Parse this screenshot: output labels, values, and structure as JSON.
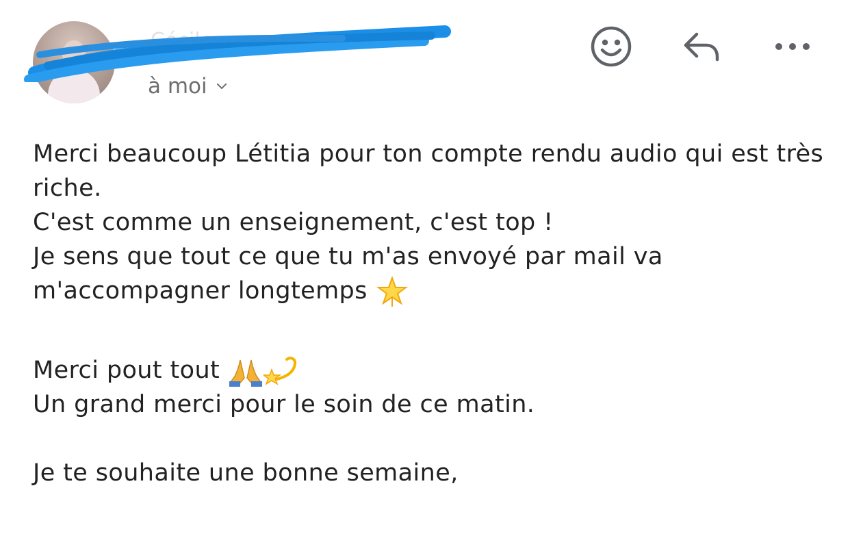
{
  "header": {
    "sender_name": "Cécile ...",
    "recipient_label": "à moi",
    "icons": {
      "emoji_reaction": "smiley-face-icon",
      "reply": "reply-arrow-icon",
      "more": "more-options-icon",
      "recipient_expand": "chevron-down-icon"
    }
  },
  "message": {
    "line1": "Merci beaucoup Létitia pour ton compte rendu audio qui est très riche.",
    "line2": "C'est comme un enseignement, c'est top !",
    "line3": "Je sens que tout ce que tu m'as envoyé par mail va m'accompagner longtemps",
    "line4": "Merci pout tout",
    "line5": "Un grand merci pour le soin de ce matin.",
    "line6": "Je te souhaite une bonne semaine,"
  },
  "colors": {
    "text": "#222222",
    "secondary_text": "#6e6e6e",
    "icon": "#5f6368",
    "redaction_blue": "#1b8fe8"
  }
}
